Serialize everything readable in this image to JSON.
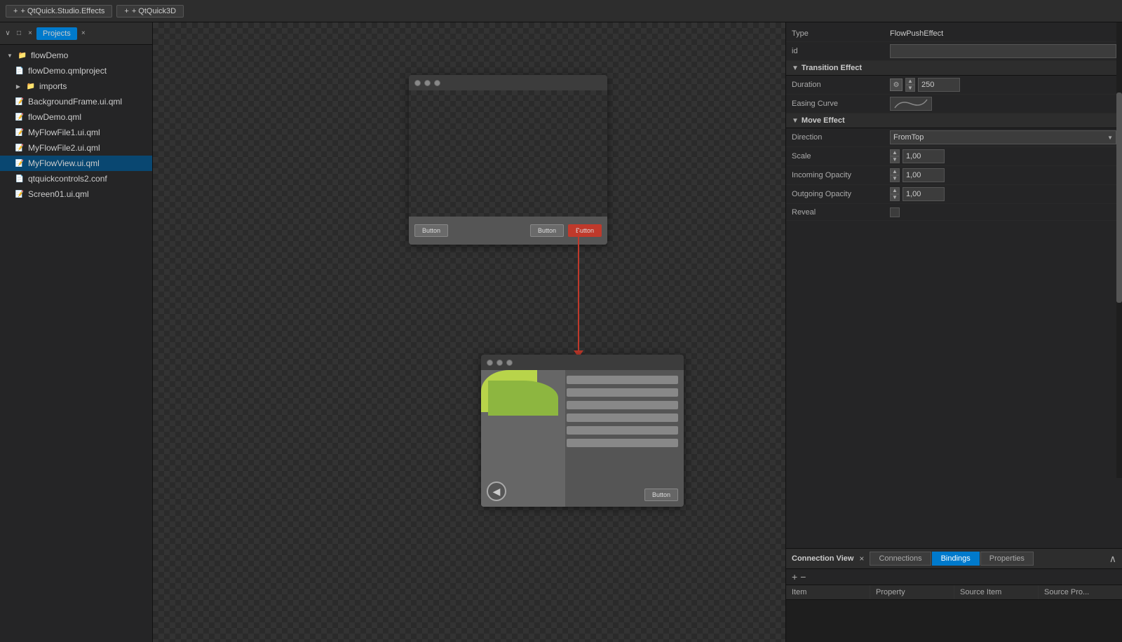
{
  "toolbar": {
    "btn1_label": "+ QtQuick.Studio.Effects",
    "btn2_label": "+ QtQuick3D"
  },
  "sidebar": {
    "panel_title": "Projects",
    "close_label": "×",
    "root_folder": "flowDemo",
    "items": [
      {
        "label": "flowDemo.qmlproject",
        "type": "file",
        "indent": 1
      },
      {
        "label": "imports",
        "type": "folder",
        "indent": 1
      },
      {
        "label": "BackgroundFrame.ui.qml",
        "type": "file",
        "indent": 1
      },
      {
        "label": "flowDemo.qml",
        "type": "file",
        "indent": 1
      },
      {
        "label": "MyFlowFile1.ui.qml",
        "type": "file",
        "indent": 1
      },
      {
        "label": "MyFlowFile2.ui.qml",
        "type": "file",
        "indent": 1
      },
      {
        "label": "MyFlowView.ui.qml",
        "type": "file",
        "indent": 1,
        "selected": true
      },
      {
        "label": "qtquickcontrols2.conf",
        "type": "file",
        "indent": 1
      },
      {
        "label": "Screen01.ui.qml",
        "type": "file",
        "indent": 1
      }
    ]
  },
  "properties": {
    "type_label": "Type",
    "type_value": "FlowPushEffect",
    "id_label": "id",
    "id_value": "",
    "transition_effect_label": "Transition Effect",
    "duration_label": "Duration",
    "duration_value": "250",
    "easing_curve_label": "Easing Curve",
    "move_effect_label": "Move Effect",
    "direction_label": "Direction",
    "direction_value": "FromTop",
    "scale_label": "Scale",
    "scale_value": "1,00",
    "incoming_opacity_label": "Incoming Opacity",
    "incoming_opacity_value": "1,00",
    "outgoing_opacity_label": "Outgoing Opacity",
    "outgoing_opacity_value": "1,00",
    "reveal_label": "Reveal"
  },
  "connection_view": {
    "title": "Connection View",
    "close_label": "×",
    "tabs": [
      {
        "label": "Connections",
        "active": false
      },
      {
        "label": "Bindings",
        "active": true
      },
      {
        "label": "Properties",
        "active": false
      }
    ],
    "add_label": "+",
    "remove_label": "−",
    "columns": [
      {
        "label": "Item"
      },
      {
        "label": "Property"
      },
      {
        "label": "Source Item"
      },
      {
        "label": "Source Pro..."
      }
    ]
  },
  "screens": {
    "screen1": {
      "buttons": [
        "Button",
        "Button",
        "Button"
      ]
    },
    "screen2": {
      "back_btn": "◀",
      "ok_btn": "Button",
      "list_bars": 6
    }
  }
}
